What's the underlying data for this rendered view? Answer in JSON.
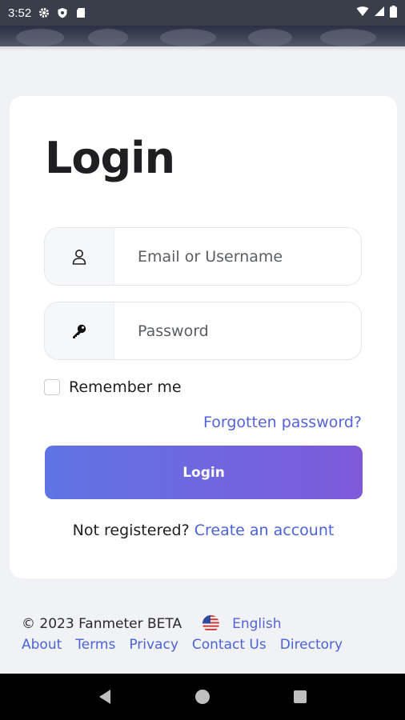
{
  "status_bar": {
    "time": "3:52",
    "icons": [
      "gear-icon",
      "shield-icon",
      "sd-card-icon"
    ],
    "right_icons": [
      "wifi-icon",
      "signal-icon",
      "battery-icon"
    ]
  },
  "login": {
    "title": "Login",
    "email_placeholder": "Email or Username",
    "password_placeholder": "Password",
    "remember_label": "Remember me",
    "forgot_link": "Forgotten password?",
    "submit_label": "Login",
    "not_registered": "Not registered?",
    "create_account_link": "Create an account"
  },
  "footer": {
    "copyright": "© 2023 Fanmeter BETA",
    "language": "English",
    "links": [
      "About",
      "Terms",
      "Privacy",
      "Contact Us",
      "Directory"
    ]
  },
  "colors": {
    "accent": "#5563d8",
    "button_gradient_start": "#5f74e4",
    "button_gradient_end": "#7e5ad9"
  }
}
